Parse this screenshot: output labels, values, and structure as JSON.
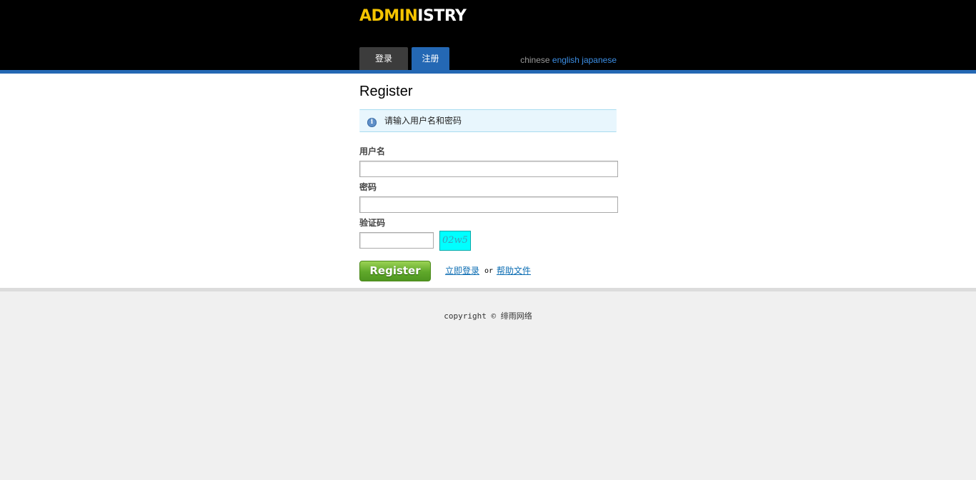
{
  "header": {
    "logo_part1": "ADMIN",
    "logo_part2": "ISTRY",
    "tabs": [
      {
        "label": "登录",
        "active": false
      },
      {
        "label": "注册",
        "active": true
      }
    ],
    "languages": {
      "current": "chinese",
      "english": "english",
      "japanese": "japanese"
    }
  },
  "main": {
    "title": "Register",
    "info_message": "请输入用户名和密码",
    "form": {
      "username_label": "用户名",
      "username_value": "",
      "password_label": "密码",
      "password_value": "",
      "captcha_label": "验证码",
      "captcha_value": "",
      "captcha_code": "02w5",
      "submit_label": "Register",
      "login_link": "立即登录",
      "or_text": "or",
      "help_link": "帮助文件"
    }
  },
  "footer": {
    "copyright": "copyright © 绯雨网络"
  },
  "colors": {
    "header_bg": "#000000",
    "accent_blue": "#2468b4",
    "logo_yellow": "#f5c400",
    "info_bg": "#e8f6fd",
    "button_green": "#5fa82a",
    "captcha_bg": "#00ffff"
  },
  "icons": {
    "info": "info-icon"
  }
}
